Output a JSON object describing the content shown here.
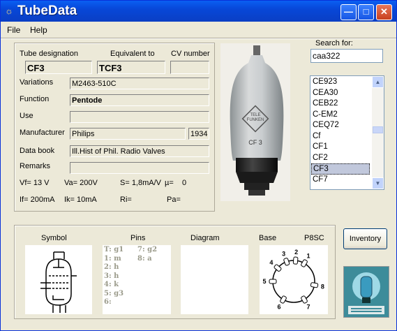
{
  "window": {
    "title": "TubeData"
  },
  "menu": {
    "file": "File",
    "help": "Help"
  },
  "details": {
    "tube_designation_label": "Tube designation",
    "equivalent_label": "Equivalent to",
    "cv_label": "CV number",
    "tube_designation": "CF3",
    "equivalent": "TCF3",
    "cv_number": "",
    "variations_label": "Variations",
    "variations": "M2463-510C",
    "function_label": "Function",
    "function": "Pentode",
    "use_label": "Use",
    "use": "",
    "manufacturer_label": "Manufacturer",
    "manufacturer": "Philips",
    "year": "1934",
    "databook_label": "Data book",
    "databook": "Ill.Hist of Phil. Radio Valves",
    "remarks_label": "Remarks",
    "remarks": "",
    "vf": "Vf= 13 V",
    "va": "Va= 200V",
    "s": "S= 1,8mA/V",
    "mu": "µ=",
    "mu_val": "0",
    "if": "If= 200mA",
    "ik": "Ik=  10mA",
    "ri": "Ri=",
    "pa": "Pa="
  },
  "search": {
    "label": "Search for:",
    "value": "caa322",
    "items": [
      "CE923",
      "CEA30",
      "CEB22",
      "C-EM2",
      "CEQ72",
      "Cf",
      "CF1",
      "CF2",
      "CF3",
      "CF7"
    ],
    "selected_index": 8
  },
  "bottom": {
    "symbol_label": "Symbol",
    "pins_label": "Pins",
    "diagram_label": "Diagram",
    "base_label": "Base",
    "base_type": "P8SC",
    "pins_col1": [
      "T: g1",
      "1: m",
      "2: h",
      "3: h",
      "4: k",
      "5: g3",
      "6:"
    ],
    "pins_col2": [
      "7: g2",
      "8: a"
    ],
    "base_pin_numbers": [
      "1",
      "2",
      "3",
      "4",
      "5",
      "6",
      "7",
      "8"
    ]
  },
  "buttons": {
    "inventory": "Inventory"
  },
  "tube_photo": {
    "brand": "TELE FUNKEN",
    "marking": "CF 3"
  }
}
